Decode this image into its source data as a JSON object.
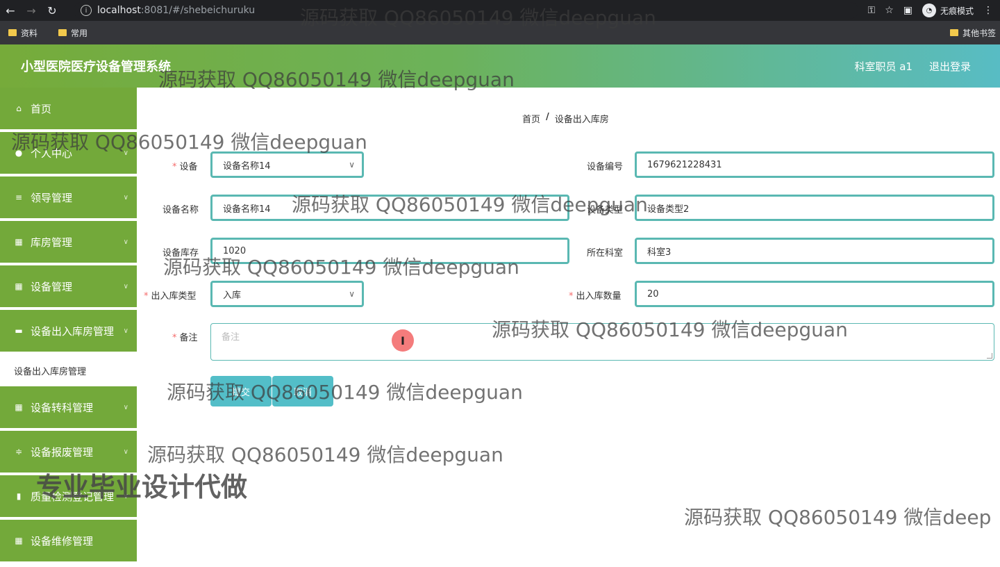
{
  "browser": {
    "url_host": "localhost",
    "url_rest": ":8081/#/shebeichuruku",
    "incognito_label": "无痕模式",
    "bookmarks": [
      "资料",
      "常用"
    ],
    "other_bookmarks": "其他书签"
  },
  "header": {
    "title": "小型医院医疗设备管理系统",
    "user_label": "科室职员 a1",
    "logout_label": "退出登录"
  },
  "sidebar": {
    "items": [
      {
        "label": "首页",
        "icon": "home-icon"
      },
      {
        "label": "个人中心",
        "icon": "user-icon"
      },
      {
        "label": "领导管理",
        "icon": "list-icon"
      },
      {
        "label": "库房管理",
        "icon": "grid-icon"
      },
      {
        "label": "设备管理",
        "icon": "grid-icon"
      },
      {
        "label": "设备出入库房管理",
        "icon": "briefcase-icon"
      },
      {
        "label": "设备转科管理",
        "icon": "grid-icon"
      },
      {
        "label": "设备报废管理",
        "icon": "sliders-icon"
      },
      {
        "label": "质量检测登记管理",
        "icon": "bar-chart-icon"
      },
      {
        "label": "设备维修管理",
        "icon": "grid-icon"
      }
    ],
    "sub_item": "设备出入库房管理"
  },
  "breadcrumb": {
    "home": "首页",
    "separator": "/",
    "current": "设备出入库房"
  },
  "form": {
    "device_label": "设备",
    "device_value": "设备名称14",
    "device_no_label": "设备编号",
    "device_no_value": "1679621228431",
    "device_name_label": "设备名称",
    "device_name_value": "设备名称14",
    "device_type_label": "设备类型",
    "device_type_value": "设备类型2",
    "stock_label": "设备库存",
    "stock_value": "1020",
    "dept_label": "所在科室",
    "dept_value": "科室3",
    "io_type_label": "出入库类型",
    "io_type_value": "入库",
    "io_qty_label": "出入库数量",
    "io_qty_value": "20",
    "remark_label": "备注",
    "remark_placeholder": "备注",
    "submit_label": "提交",
    "cancel_label": "取消"
  },
  "watermark": {
    "text": "源码获取 QQ86050149 微信deepguan",
    "text_cut": "源码获取 QQ86050149 微信deep",
    "big_text": "专业毕业设计代做"
  }
}
